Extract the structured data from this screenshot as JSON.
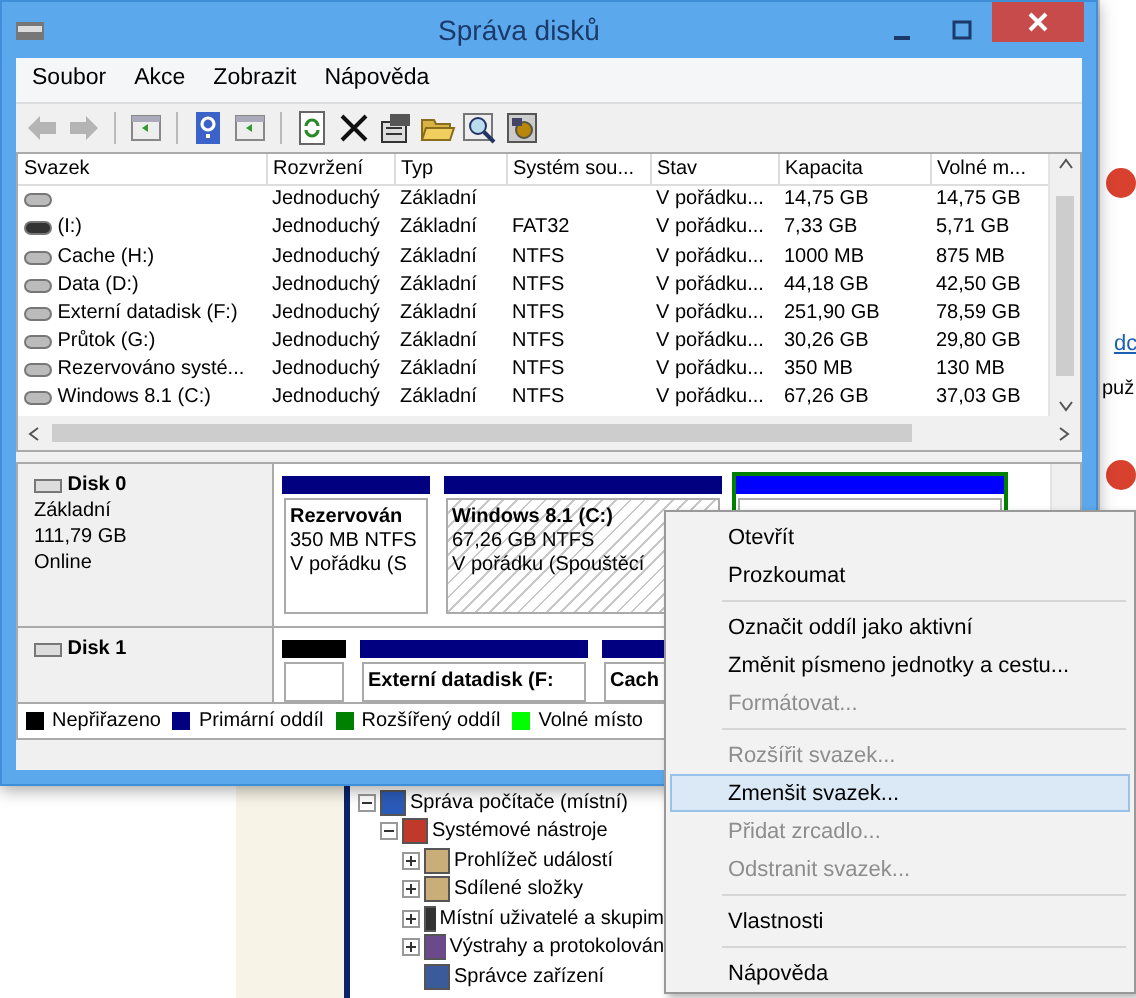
{
  "window": {
    "title": "Správa disků"
  },
  "menu": [
    "Soubor",
    "Akce",
    "Zobrazit",
    "Nápověda"
  ],
  "toolbar": [
    [
      {
        "kind": "back",
        "disabled": true
      },
      {
        "kind": "forward",
        "disabled": true
      }
    ],
    [
      {
        "kind": "pane",
        "disabled": false
      }
    ],
    [
      {
        "kind": "help",
        "disabled": false
      },
      {
        "kind": "pane",
        "disabled": false
      }
    ],
    [
      {
        "kind": "refresh",
        "disabled": false
      },
      {
        "kind": "delete",
        "disabled": false
      },
      {
        "kind": "properties",
        "disabled": false
      },
      {
        "kind": "open",
        "disabled": false
      },
      {
        "kind": "search",
        "disabled": false
      },
      {
        "kind": "settings",
        "disabled": false
      }
    ]
  ],
  "table": {
    "columns": [
      "Svazek",
      "Rozvržení",
      "Typ",
      "Systém sou...",
      "Stav",
      "Kapacita",
      "Volné m..."
    ],
    "rows": [
      {
        "kind": "disk",
        "cells": [
          null,
          "Jednoduchý",
          "Základní",
          null,
          "V pořádku...",
          "14,75 GB",
          "14,75 GB"
        ]
      },
      {
        "kind": "removable",
        "cells": [
          "(I:)",
          "Jednoduchý",
          "Základní",
          "FAT32",
          "V pořádku...",
          "7,33 GB",
          "5,71 GB"
        ]
      },
      {
        "kind": "disk",
        "cells": [
          "Cache (H:)",
          "Jednoduchý",
          "Základní",
          "NTFS",
          "V pořádku...",
          "1000 MB",
          "875 MB"
        ]
      },
      {
        "kind": "disk",
        "cells": [
          "Data (D:)",
          "Jednoduchý",
          "Základní",
          "NTFS",
          "V pořádku...",
          "44,18 GB",
          "42,50 GB"
        ]
      },
      {
        "kind": "disk",
        "cells": [
          "Externí datadisk (F:)",
          "Jednoduchý",
          "Základní",
          "NTFS",
          "V pořádku...",
          "251,90 GB",
          "78,59 GB"
        ]
      },
      {
        "kind": "disk",
        "cells": [
          "Průtok (G:)",
          "Jednoduchý",
          "Základní",
          "NTFS",
          "V pořádku...",
          "30,26 GB",
          "29,80 GB"
        ]
      },
      {
        "kind": "disk",
        "cells": [
          "Rezervováno systé...",
          "Jednoduchý",
          "Základní",
          "NTFS",
          "V pořádku...",
          "350 MB",
          "130 MB"
        ]
      },
      {
        "kind": "disk",
        "cells": [
          "Windows 8.1 (C:)",
          "Jednoduchý",
          "Základní",
          "NTFS",
          "V pořádku...",
          "67,26 GB",
          "37,03 GB"
        ]
      }
    ]
  },
  "disks": [
    {
      "name": "Disk 0",
      "lines": [
        "Základní",
        "111,79 GB",
        "Online"
      ],
      "partitions": [
        {
          "kind": "primary",
          "selected": false,
          "title": "Rezervován",
          "lines": [
            "350 MB NTFS",
            "V pořádku (S"
          ]
        },
        {
          "kind": "primary",
          "selected": true,
          "title": "Windows 8.1  (C:)",
          "lines": [
            "67,26 GB NTFS",
            "V pořádku (Spouštěcí"
          ]
        },
        {
          "kind": "logical",
          "selected": false
        }
      ]
    },
    {
      "name": "Disk 1",
      "partitions": [
        {
          "kind": "unallocated",
          "selected": false
        },
        {
          "kind": "primary",
          "selected": false,
          "title": "Externí datadisk  (F:"
        },
        {
          "kind": "primary",
          "selected": false,
          "title": "Cach"
        }
      ]
    }
  ],
  "legend": [
    {
      "label": "Nepřiřazeno",
      "color": "#000000"
    },
    {
      "label": "Primární oddíl",
      "color": "#000080"
    },
    {
      "label": "Rozšířený oddíl",
      "color": "#008000"
    },
    {
      "label": "Volné místo",
      "color": "#00ff00"
    }
  ],
  "context_menu": [
    [
      {
        "label": "Otevřít",
        "disabled": false,
        "selected": false
      },
      {
        "label": "Prozkoumat",
        "disabled": false,
        "selected": false
      }
    ],
    [
      {
        "label": "Označit oddíl jako aktivní",
        "disabled": false,
        "selected": false
      },
      {
        "label": "Změnit písmeno jednotky a cestu...",
        "disabled": false,
        "selected": false
      },
      {
        "label": "Formátovat...",
        "disabled": true,
        "selected": false
      }
    ],
    [
      {
        "label": "Rozšířit svazek...",
        "disabled": true,
        "selected": false
      },
      {
        "label": "Zmenšit svazek...",
        "disabled": false,
        "selected": true
      },
      {
        "label": "Přidat zrcadlo...",
        "disabled": true,
        "selected": false
      },
      {
        "label": "Odstranit svazek...",
        "disabled": true,
        "selected": false
      }
    ],
    [
      {
        "label": "Vlastnosti",
        "disabled": false,
        "selected": false
      }
    ],
    [
      {
        "label": "Nápověda",
        "disabled": false,
        "selected": false
      }
    ]
  ],
  "background": {
    "link": "dc",
    "text": "puž",
    "tree": [
      {
        "label": "Správa počítače (místní)",
        "expanded": true,
        "children": [
          {
            "label": "Systémové nástroje",
            "expanded": true,
            "children": [
              {
                "label": "Prohlížeč událostí",
                "expanded": false
              },
              {
                "label": "Sdílené složky",
                "expanded": false
              },
              {
                "label": "Místní uživatelé a skupim",
                "expanded": false
              },
              {
                "label": "Výstrahy a protokolován",
                "expanded": false
              },
              {
                "label": "Správce zařízení"
              }
            ]
          }
        ]
      }
    ]
  }
}
